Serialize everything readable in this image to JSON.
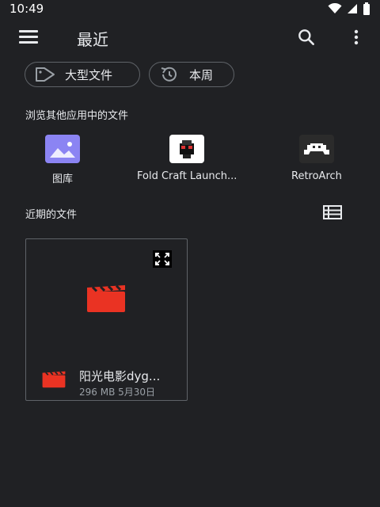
{
  "status_bar": {
    "time": "10:49"
  },
  "app_bar": {
    "title": "最近"
  },
  "chips": [
    {
      "label": "大型文件",
      "icon": "tag-icon"
    },
    {
      "label": "本周",
      "icon": "history-icon"
    }
  ],
  "apps_section": {
    "label": "浏览其他应用中的文件",
    "apps": [
      {
        "name": "图库",
        "icon": "gallery-icon"
      },
      {
        "name": "Fold Craft Launch...",
        "icon": "fold-craft-icon"
      },
      {
        "name": "RetroArch",
        "icon": "retroarch-icon"
      }
    ]
  },
  "recent_section": {
    "label": "近期的文件",
    "files": [
      {
        "name": "阳光电影dyg...",
        "size": "296 MB",
        "date": "5月30日",
        "type_icon": "video-icon"
      }
    ]
  },
  "colors": {
    "background": "#202124",
    "accent_video": "#ea3323"
  }
}
